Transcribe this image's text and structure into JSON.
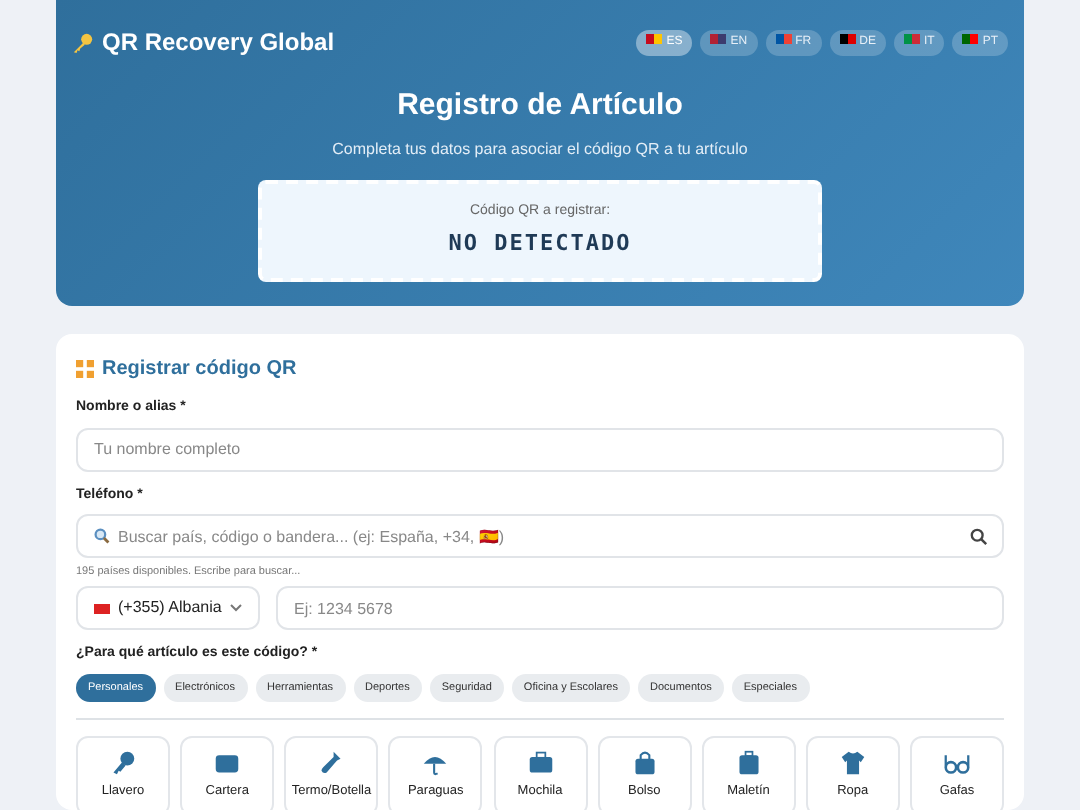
{
  "header": {
    "brand": "QR Recovery Global",
    "languages": [
      {
        "code": "ES",
        "selected": true
      },
      {
        "code": "EN",
        "selected": false
      },
      {
        "code": "FR",
        "selected": false
      },
      {
        "code": "DE",
        "selected": false
      },
      {
        "code": "IT",
        "selected": false
      },
      {
        "code": "PT",
        "selected": false
      }
    ],
    "title": "Registro de Artículo",
    "subtitle": "Completa tus datos para asociar el código QR a tu artículo",
    "qr_label": "Código QR a registrar:",
    "qr_value": "NO DETECTADO"
  },
  "form": {
    "title": "Registrar código QR",
    "name": {
      "label": "Nombre o alias *",
      "placeholder": "Tu nombre completo"
    },
    "phone": {
      "label": "Teléfono *",
      "search_placeholder": "Buscar país, código o bandera... (ej: España, +34, 🇪🇸)",
      "hint": "195 países disponibles. Escribe para buscar...",
      "country": "(+355) Albania",
      "number_placeholder": "Ej: 1234 5678"
    },
    "article": {
      "label": "¿Para qué artículo es este código? *",
      "categories": [
        {
          "label": "Personales",
          "selected": true
        },
        {
          "label": "Electrónicos",
          "selected": false
        },
        {
          "label": "Herramientas",
          "selected": false
        },
        {
          "label": "Deportes",
          "selected": false
        },
        {
          "label": "Seguridad",
          "selected": false
        },
        {
          "label": "Oficina y Escolares",
          "selected": false
        },
        {
          "label": "Documentos",
          "selected": false
        },
        {
          "label": "Especiales",
          "selected": false
        }
      ],
      "items": [
        {
          "label": "Llavero",
          "kind": "key"
        },
        {
          "label": "Cartera",
          "kind": "wallet"
        },
        {
          "label": "Termo/Botella",
          "kind": "bottle"
        },
        {
          "label": "Paraguas",
          "kind": "umbrella"
        },
        {
          "label": "Mochila",
          "kind": "briefcase"
        },
        {
          "label": "Bolso",
          "kind": "bag"
        },
        {
          "label": "Maletín",
          "kind": "suitcase"
        },
        {
          "label": "Ropa",
          "kind": "shirt"
        },
        {
          "label": "Gafas",
          "kind": "glasses"
        }
      ]
    }
  }
}
